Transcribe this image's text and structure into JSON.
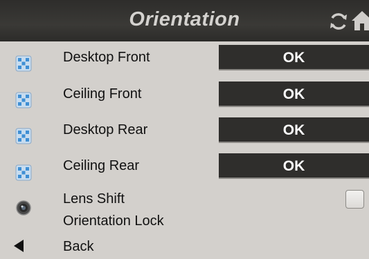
{
  "header": {
    "title": "Orientation",
    "icons": [
      "refresh-icon",
      "home-icon"
    ]
  },
  "menu": {
    "items": [
      {
        "label": "Desktop Front",
        "button_label": "OK",
        "icon": "orientation-icon"
      },
      {
        "label": "Ceiling Front",
        "button_label": "OK",
        "icon": "orientation-icon"
      },
      {
        "label": "Desktop Rear",
        "button_label": "OK",
        "icon": "orientation-icon"
      },
      {
        "label": "Ceiling Rear",
        "button_label": "OK",
        "icon": "orientation-icon"
      }
    ],
    "lens_shift": {
      "label_line1": "Lens Shift",
      "label_line2": "Orientation Lock",
      "icon": "lens-icon",
      "checked": false
    },
    "back": {
      "label": "Back",
      "icon": "back-arrow-icon"
    }
  },
  "colors": {
    "background": "#d3d0cc",
    "header": "#34332f",
    "button": "#2f2e2c",
    "button_text": "#ffffff"
  }
}
